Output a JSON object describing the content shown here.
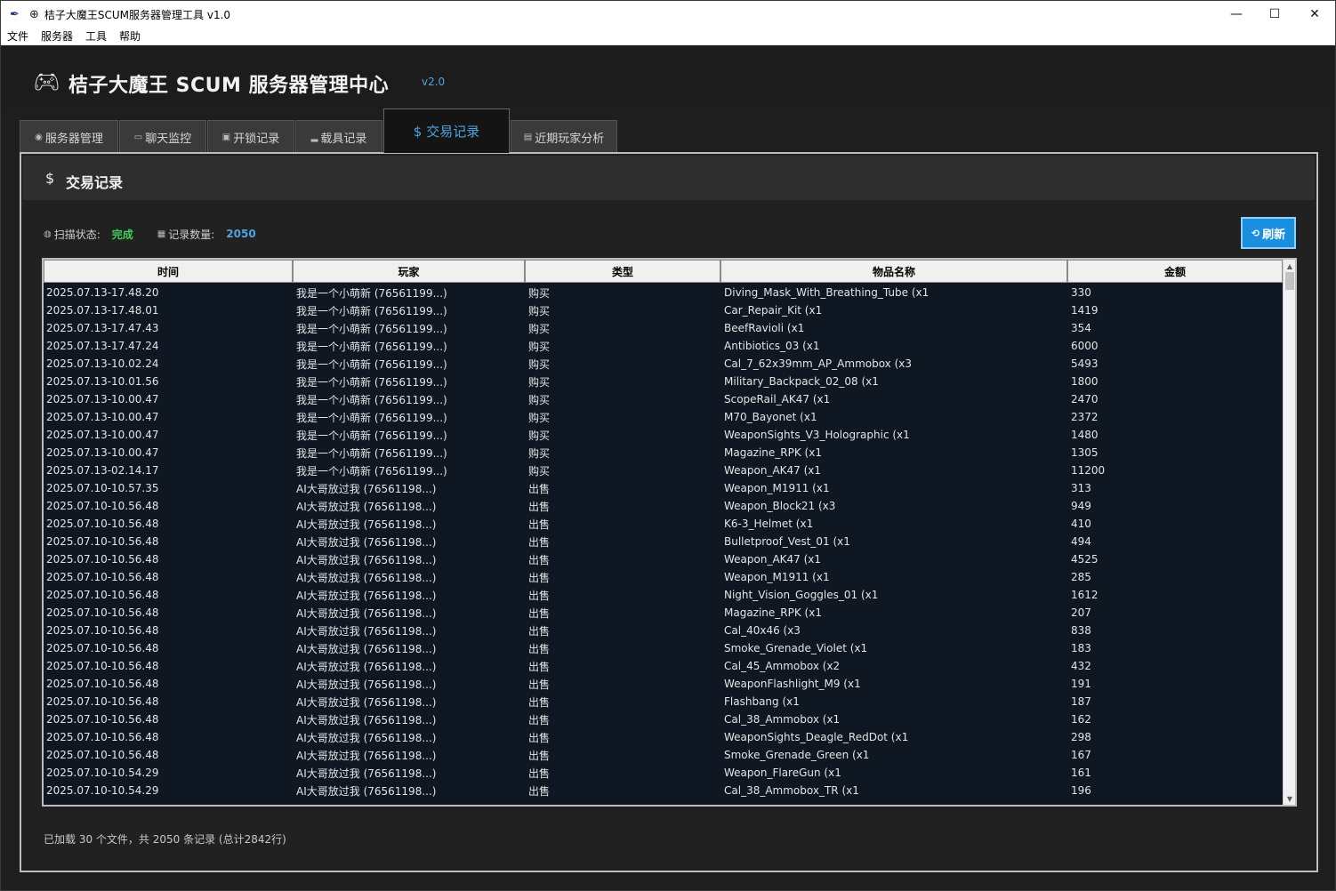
{
  "window": {
    "title": "桔子大魔王SCUM服务器管理工具 v1.0",
    "minimize": "—",
    "maximize": "☐",
    "close": "✕"
  },
  "menu": [
    "文件",
    "服务器",
    "工具",
    "帮助"
  ],
  "header": {
    "title": "桔子大魔王 SCUM 服务器管理中心",
    "version": "v2.0"
  },
  "tabs": [
    {
      "label": "服务器管理",
      "icon": "gamepad-icon"
    },
    {
      "label": "聊天监控",
      "icon": "chat-icon"
    },
    {
      "label": "开锁记录",
      "icon": "lock-icon"
    },
    {
      "label": "载具记录",
      "icon": "car-icon"
    },
    {
      "label": "交易记录",
      "icon": "money-bag-icon"
    },
    {
      "label": "近期玩家分析",
      "icon": "analysis-icon"
    }
  ],
  "active_tab": "交易记录",
  "panel": {
    "title": "交易记录",
    "scan_label": "扫描状态:",
    "scan_value": "完成",
    "count_label": "记录数量:",
    "count_value": "2050",
    "refresh_label": "刷新"
  },
  "table": {
    "columns": [
      "时间",
      "玩家",
      "类型",
      "物品名称",
      "金额"
    ],
    "rows": [
      [
        "2025.07.13-17.48.20",
        "我是一个小萌新 (76561199...)",
        "购买",
        "Diving_Mask_With_Breathing_Tube (x1",
        "330"
      ],
      [
        "2025.07.13-17.48.01",
        "我是一个小萌新 (76561199...)",
        "购买",
        "Car_Repair_Kit (x1",
        "1419"
      ],
      [
        "2025.07.13-17.47.43",
        "我是一个小萌新 (76561199...)",
        "购买",
        "BeefRavioli (x1",
        "354"
      ],
      [
        "2025.07.13-17.47.24",
        "我是一个小萌新 (76561199...)",
        "购买",
        "Antibiotics_03 (x1",
        "6000"
      ],
      [
        "2025.07.13-10.02.24",
        "我是一个小萌新 (76561199...)",
        "购买",
        "Cal_7_62x39mm_AP_Ammobox (x3",
        "5493"
      ],
      [
        "2025.07.13-10.01.56",
        "我是一个小萌新 (76561199...)",
        "购买",
        "Military_Backpack_02_08 (x1",
        "1800"
      ],
      [
        "2025.07.13-10.00.47",
        "我是一个小萌新 (76561199...)",
        "购买",
        "ScopeRail_AK47 (x1",
        "2470"
      ],
      [
        "2025.07.13-10.00.47",
        "我是一个小萌新 (76561199...)",
        "购买",
        "M70_Bayonet (x1",
        "2372"
      ],
      [
        "2025.07.13-10.00.47",
        "我是一个小萌新 (76561199...)",
        "购买",
        "WeaponSights_V3_Holographic (x1",
        "1480"
      ],
      [
        "2025.07.13-10.00.47",
        "我是一个小萌新 (76561199...)",
        "购买",
        "Magazine_RPK (x1",
        "1305"
      ],
      [
        "2025.07.13-02.14.17",
        "我是一个小萌新 (76561199...)",
        "购买",
        "Weapon_AK47 (x1",
        "11200"
      ],
      [
        "2025.07.10-10.57.35",
        "AI大哥放过我 (76561198...)",
        "出售",
        "Weapon_M1911 (x1",
        "313"
      ],
      [
        "2025.07.10-10.56.48",
        "AI大哥放过我 (76561198...)",
        "出售",
        "Weapon_Block21 (x3",
        "949"
      ],
      [
        "2025.07.10-10.56.48",
        "AI大哥放过我 (76561198...)",
        "出售",
        "K6-3_Helmet (x1",
        "410"
      ],
      [
        "2025.07.10-10.56.48",
        "AI大哥放过我 (76561198...)",
        "出售",
        "Bulletproof_Vest_01 (x1",
        "494"
      ],
      [
        "2025.07.10-10.56.48",
        "AI大哥放过我 (76561198...)",
        "出售",
        "Weapon_AK47 (x1",
        "4525"
      ],
      [
        "2025.07.10-10.56.48",
        "AI大哥放过我 (76561198...)",
        "出售",
        "Weapon_M1911 (x1",
        "285"
      ],
      [
        "2025.07.10-10.56.48",
        "AI大哥放过我 (76561198...)",
        "出售",
        "Night_Vision_Goggles_01 (x1",
        "1612"
      ],
      [
        "2025.07.10-10.56.48",
        "AI大哥放过我 (76561198...)",
        "出售",
        "Magazine_RPK (x1",
        "207"
      ],
      [
        "2025.07.10-10.56.48",
        "AI大哥放过我 (76561198...)",
        "出售",
        "Cal_40x46 (x3",
        "838"
      ],
      [
        "2025.07.10-10.56.48",
        "AI大哥放过我 (76561198...)",
        "出售",
        "Smoke_Grenade_Violet (x1",
        "183"
      ],
      [
        "2025.07.10-10.56.48",
        "AI大哥放过我 (76561198...)",
        "出售",
        "Cal_45_Ammobox (x2",
        "432"
      ],
      [
        "2025.07.10-10.56.48",
        "AI大哥放过我 (76561198...)",
        "出售",
        "WeaponFlashlight_M9 (x1",
        "191"
      ],
      [
        "2025.07.10-10.56.48",
        "AI大哥放过我 (76561198...)",
        "出售",
        "Flashbang (x1",
        "187"
      ],
      [
        "2025.07.10-10.56.48",
        "AI大哥放过我 (76561198...)",
        "出售",
        "Cal_38_Ammobox (x1",
        "162"
      ],
      [
        "2025.07.10-10.56.48",
        "AI大哥放过我 (76561198...)",
        "出售",
        "WeaponSights_Deagle_RedDot (x1",
        "298"
      ],
      [
        "2025.07.10-10.56.48",
        "AI大哥放过我 (76561198...)",
        "出售",
        "Smoke_Grenade_Green (x1",
        "167"
      ],
      [
        "2025.07.10-10.54.29",
        "AI大哥放过我 (76561198...)",
        "出售",
        "Weapon_FlareGun (x1",
        "161"
      ],
      [
        "2025.07.10-10.54.29",
        "AI大哥放过我 (76561198...)",
        "出售",
        "Cal_38_Ammobox_TR (x1",
        "196"
      ]
    ]
  },
  "footer": "已加载 30 个文件，共 2050 条记录 (总计2842行)",
  "colors": {
    "accent": "#4fa3e0",
    "status_ok": "#3fcf5a",
    "table_bg": "#0f1722",
    "button": "#1a8fe0"
  }
}
